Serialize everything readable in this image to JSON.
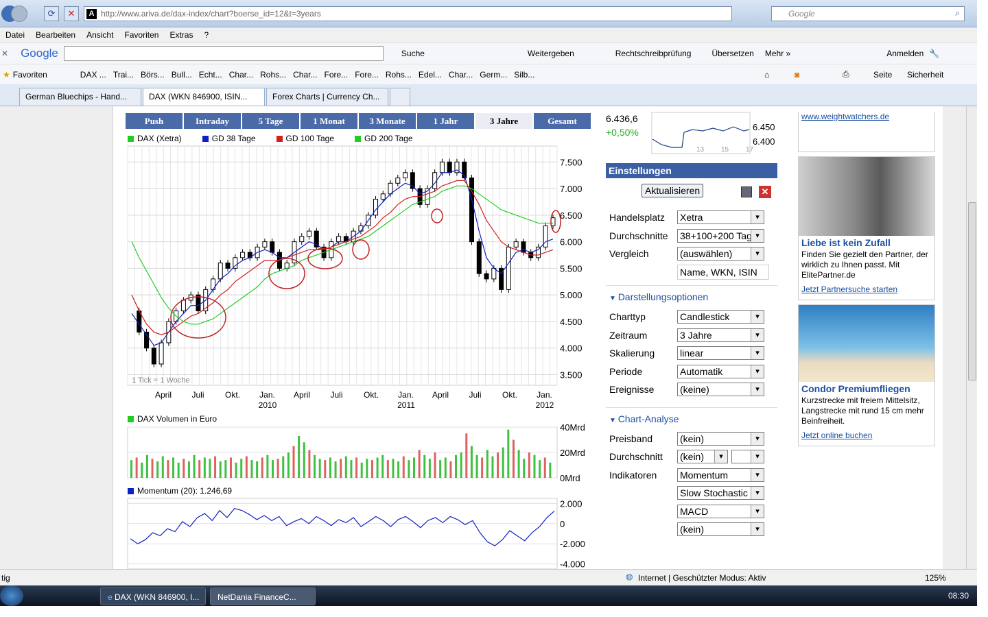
{
  "browser": {
    "url": "http://www.ariva.de/dax-index/chart?boerse_id=12&t=3years",
    "search_placeholder": "Google",
    "menu": [
      "Datei",
      "Bearbeiten",
      "Ansicht",
      "Favoriten",
      "Extras",
      "?"
    ],
    "google_bar": {
      "logo": "Google",
      "search": "Suche",
      "share": "Weitergeben",
      "spell": "Rechtschreibprüfung",
      "translate": "Übersetzen",
      "more": "Mehr »",
      "signin": "Anmelden"
    },
    "favorites_label": "Favoriten",
    "favorites": [
      "DAX ...",
      "Trai...",
      "Börs...",
      "Bull...",
      "Echt...",
      "Char...",
      "Rohs...",
      "Char...",
      "Fore...",
      "Fore...",
      "Rohs...",
      "Edel...",
      "Char...",
      "Germ...",
      "Silb..."
    ],
    "toolbar_right": {
      "page": "Seite",
      "security": "Sicherheit"
    },
    "tabs": [
      "German Bluechips - Hand...",
      "DAX (WKN 846900, ISIN...",
      "Forex Charts | Currency Ch..."
    ],
    "status": {
      "left": "tig",
      "zone": "Internet | Geschützter Modus: Aktiv",
      "zoom": "125%"
    }
  },
  "period_tabs": [
    "Push",
    "Intraday",
    "5 Tage",
    "1 Monat",
    "3 Monate",
    "1 Jahr",
    "3 Jahre",
    "Gesamt"
  ],
  "legend": [
    {
      "label": "DAX (Xetra)",
      "color": "#22cc22"
    },
    {
      "label": "GD 38 Tage",
      "color": "#1020c0"
    },
    {
      "label": "GD 100 Tage",
      "color": "#d02020"
    },
    {
      "label": "GD 200 Tage",
      "color": "#22cc22"
    }
  ],
  "chart_data": [
    {
      "type": "line",
      "title": "",
      "y_ticks": [
        "7.500",
        "7.000",
        "6.500",
        "6.000",
        "5.500",
        "5.000",
        "4.500",
        "4.000",
        "3.500"
      ],
      "ylim": [
        3300,
        7800
      ],
      "x_ticks": [
        "April",
        "Juli",
        "Okt.",
        "Jan.",
        "April",
        "Juli",
        "Okt.",
        "Jan.",
        "April",
        "Juli",
        "Okt.",
        "Jan."
      ],
      "x_years": [
        "2010",
        "2011",
        "2012"
      ],
      "note": "1 Tick = 1 Woche",
      "series": [
        {
          "name": "DAX (Xetra)",
          "values": [
            4700,
            4300,
            4000,
            3700,
            4100,
            4500,
            4700,
            4900,
            5000,
            4700,
            5100,
            5300,
            5600,
            5500,
            5700,
            5800,
            5700,
            5900,
            6000,
            5800,
            5500,
            5600,
            6000,
            6100,
            6200,
            5900,
            5700,
            6000,
            6100,
            6000,
            6200,
            6300,
            6500,
            6800,
            6900,
            7100,
            7200,
            7300,
            7000,
            6700,
            7000,
            7300,
            7500,
            7300,
            7500,
            7200,
            6000,
            5400,
            5300,
            5500,
            5100,
            5900,
            6000,
            5800,
            5700,
            5900,
            6300,
            6450
          ]
        },
        {
          "name": "GD 38 Tage",
          "values": [
            4650,
            4450,
            4250,
            4050,
            4100,
            4300,
            4500,
            4650,
            4800,
            4800,
            4900,
            5100,
            5300,
            5400,
            5550,
            5650,
            5700,
            5800,
            5850,
            5800,
            5700,
            5700,
            5800,
            5900,
            6000,
            5950,
            5850,
            5900,
            6000,
            6000,
            6100,
            6200,
            6400,
            6600,
            6750,
            6900,
            7000,
            7100,
            7050,
            6900,
            6950,
            7100,
            7300,
            7300,
            7350,
            7250,
            6800,
            6200,
            5700,
            5500,
            5400,
            5600,
            5800,
            5850,
            5800,
            5850,
            6000,
            6050
          ]
        },
        {
          "name": "GD 100 Tage",
          "values": [
            5000,
            4700,
            4450,
            4300,
            4250,
            4300,
            4400,
            4500,
            4600,
            4650,
            4750,
            4850,
            5000,
            5100,
            5250,
            5350,
            5450,
            5550,
            5650,
            5650,
            5650,
            5700,
            5750,
            5800,
            5850,
            5850,
            5850,
            5900,
            5950,
            6000,
            6050,
            6100,
            6200,
            6300,
            6450,
            6550,
            6700,
            6800,
            6850,
            6850,
            6900,
            6950,
            7050,
            7100,
            7150,
            7150,
            6950,
            6700,
            6400,
            6200,
            6000,
            5900,
            5850,
            5800,
            5750,
            5750,
            5800,
            5850
          ]
        },
        {
          "name": "GD 200 Tage",
          "values": [
            6000,
            5700,
            5450,
            5200,
            4950,
            4750,
            4600,
            4500,
            4450,
            4450,
            4500,
            4550,
            4650,
            4750,
            4850,
            4950,
            5050,
            5150,
            5300,
            5400,
            5450,
            5500,
            5550,
            5650,
            5700,
            5750,
            5800,
            5850,
            5900,
            5950,
            6000,
            6050,
            6100,
            6200,
            6300,
            6400,
            6500,
            6600,
            6700,
            6750,
            6800,
            6850,
            6950,
            7000,
            7050,
            7050,
            7000,
            6900,
            6800,
            6700,
            6600,
            6550,
            6500,
            6450,
            6400,
            6350,
            6350,
            6350
          ]
        }
      ]
    },
    {
      "type": "bar",
      "title": "DAX Volumen in Euro",
      "y_ticks": [
        "40Mrd",
        "20Mrd",
        "0Mrd"
      ],
      "ylim": [
        0,
        40
      ],
      "values": [
        14,
        16,
        12,
        18,
        15,
        13,
        17,
        14,
        16,
        12,
        15,
        13,
        18,
        14,
        16,
        15,
        17,
        13,
        14,
        16,
        12,
        15,
        17,
        14,
        13,
        16,
        18,
        14,
        15,
        17,
        20,
        25,
        33,
        28,
        22,
        18,
        15,
        14,
        16,
        13,
        15,
        17,
        14,
        16,
        12,
        15,
        14,
        16,
        18,
        14,
        15,
        13,
        17,
        14,
        16,
        22,
        18,
        15,
        20,
        14,
        16,
        13,
        18,
        20,
        35,
        25,
        18,
        16,
        22,
        17,
        20,
        24,
        38,
        30,
        22,
        15,
        20,
        18,
        14,
        16,
        12
      ]
    },
    {
      "type": "line",
      "title": "Momentum (20): 1.246,69",
      "y_ticks": [
        "2.000",
        "0",
        "-2.000",
        "-4.000"
      ],
      "ylim": [
        -4500,
        2500
      ],
      "series": [
        {
          "name": "Momentum (20)",
          "values": [
            -1500,
            -2000,
            -1600,
            -900,
            -1200,
            -500,
            -800,
            200,
            -300,
            600,
            1000,
            300,
            1300,
            600,
            1500,
            1300,
            900,
            400,
            800,
            300,
            700,
            -200,
            200,
            500,
            0,
            700,
            300,
            -200,
            400,
            100,
            600,
            -300,
            200,
            700,
            300,
            -300,
            400,
            700,
            200,
            -400,
            300,
            600,
            100,
            700,
            400,
            -100,
            300,
            -900,
            -1800,
            -2200,
            -1600,
            -700,
            -1200,
            -1700,
            -900,
            -300,
            600,
            1246
          ]
        }
      ]
    }
  ],
  "quote": {
    "price": "6.436,6",
    "change": "+0,50%",
    "spark_ticks": [
      "6.450",
      "6.400"
    ],
    "spark_x": [
      "13",
      "15",
      "17"
    ]
  },
  "settings": {
    "header": "Einstellungen",
    "update_button": "Aktualisieren",
    "rows": [
      {
        "label": "Handelsplatz",
        "value": "Xetra"
      },
      {
        "label": "Durchschnitte",
        "value": "38+100+200 Tage"
      },
      {
        "label": "Vergleich",
        "value": "(auswählen)"
      }
    ],
    "compare_input_placeholder": "Name, WKN, ISIN",
    "display_section": "Darstellungsoptionen",
    "display_rows": [
      {
        "label": "Charttyp",
        "value": "Candlestick"
      },
      {
        "label": "Zeitraum",
        "value": "3 Jahre"
      },
      {
        "label": "Skalierung",
        "value": "linear"
      },
      {
        "label": "Periode",
        "value": "Automatik"
      },
      {
        "label": "Ereignisse",
        "value": "(keine)"
      }
    ],
    "analysis_section": "Chart-Analyse",
    "analysis_rows": [
      {
        "label": "Preisband",
        "value": "(kein)"
      },
      {
        "label": "Durchschnitt",
        "value": "(kein)"
      },
      {
        "label": "Indikatoren",
        "value": "Momentum"
      },
      {
        "label": "",
        "value": "Slow Stochastic"
      },
      {
        "label": "",
        "value": "MACD"
      },
      {
        "label": "",
        "value": "(kein)"
      }
    ]
  },
  "ads": {
    "link_top": "www.weightwatchers.de",
    "ad1": {
      "title": "Liebe ist kein Zufall",
      "text": "Finden Sie gezielt den Partner, der wirklich zu Ihnen passt. Mit ElitePartner.de",
      "link": "Jetzt Partnersuche starten"
    },
    "ad2": {
      "title": "Condor Premiumfliegen",
      "text": "Kurzstrecke mit freiem Mittelsitz, Langstrecke mit rund 15 cm mehr Beinfreiheit.",
      "link": "Jetzt online buchen"
    }
  },
  "taskbar": {
    "items": [
      "DAX (WKN 846900, I...",
      "NetDania FinanceC..."
    ],
    "clock": "08:30"
  }
}
